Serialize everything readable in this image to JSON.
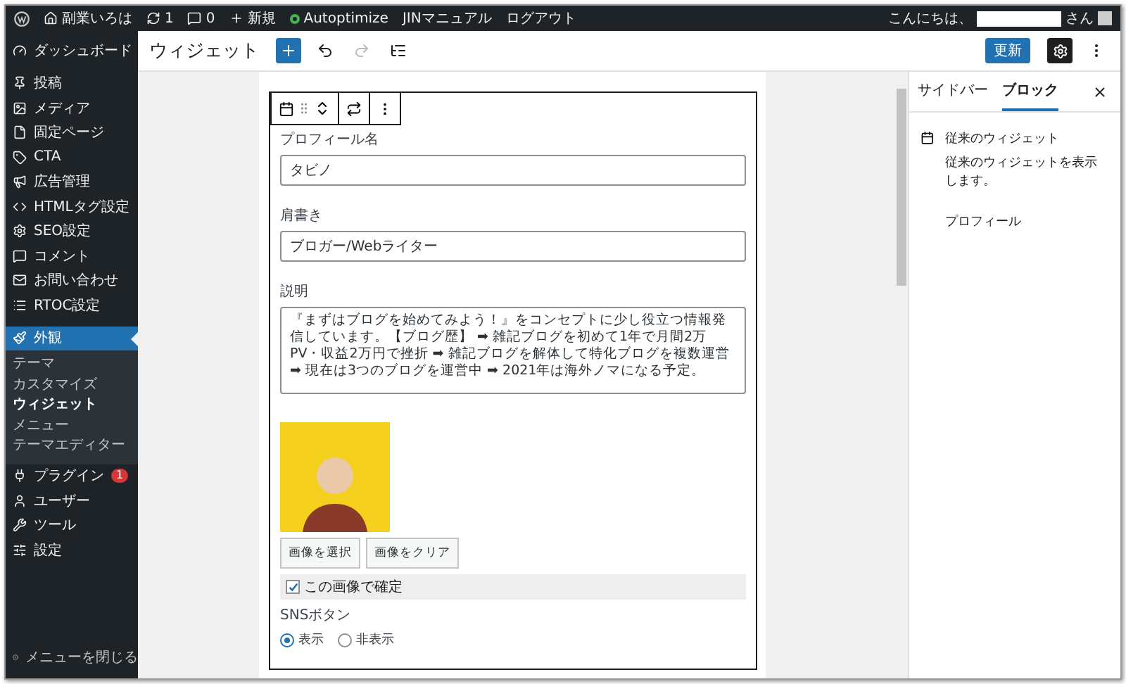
{
  "admin_bar": {
    "site": "副業いろは",
    "updates": "1",
    "comments": "0",
    "new": "新規",
    "plugin": {
      "label": "Autoptimize",
      "color": "#46b450"
    },
    "links": [
      "JINマニュアル",
      "ログアウト"
    ],
    "greeting": "こんにちは、",
    "greeting_suffix": "さん"
  },
  "sidebar": {
    "items": [
      {
        "label": "ダッシュボード",
        "selected": false
      },
      {
        "label": "投稿",
        "selected": false
      },
      {
        "label": "メディア",
        "selected": false
      },
      {
        "label": "固定ページ",
        "selected": false
      },
      {
        "label": "CTA",
        "selected": false
      },
      {
        "label": "広告管理",
        "selected": false
      },
      {
        "label": "HTMLタグ設定",
        "selected": false
      },
      {
        "label": "SEO設定",
        "selected": false
      },
      {
        "label": "コメント",
        "selected": false
      },
      {
        "label": "お問い合わせ",
        "selected": false
      },
      {
        "label": "RTOC設定",
        "selected": false
      },
      {
        "label": "外観",
        "selected": true,
        "children": [
          {
            "label": "テーマ",
            "selected": false
          },
          {
            "label": "カスタマイズ",
            "selected": false
          },
          {
            "label": "ウィジェット",
            "selected": true
          },
          {
            "label": "メニュー",
            "selected": false
          },
          {
            "label": "テーマエディター",
            "selected": false
          }
        ]
      },
      {
        "label": "プラグイン",
        "selected": false,
        "badge": "1"
      },
      {
        "label": "ユーザー",
        "selected": false
      },
      {
        "label": "ツール",
        "selected": false
      },
      {
        "label": "設定",
        "selected": false
      }
    ],
    "collapse": "メニューを閉じる"
  },
  "header": {
    "title": "ウィジェット",
    "update_button": "更新"
  },
  "block": {
    "fields": [
      {
        "kind": "text",
        "label": "プロフィール名",
        "value": "タビノ"
      },
      {
        "kind": "text",
        "label": "肩書き",
        "value": "ブロガー/Webライター"
      },
      {
        "kind": "textarea",
        "label": "説明",
        "value": "『まずはブログを始めてみよう！』をコンセプトに少し役立つ情報発信しています。【ブログ歴】 ➡ 雑記ブログを初めて1年で月間2万PV・収益2万円で挫折 ➡ 雑記ブログを解体して特化ブログを複数運営 ➡ 現在は3つのブログを運営中 ➡ 2021年は海外ノマになる予定。"
      }
    ],
    "image_buttons": [
      "画像を選択",
      "画像をクリア"
    ],
    "confirm": {
      "label": "この画像で確定",
      "checked": true
    },
    "sns": {
      "label": "SNSボタン",
      "options": [
        {
          "label": "表示",
          "selected": true
        },
        {
          "label": "非表示",
          "selected": false
        }
      ]
    }
  },
  "panel": {
    "tabs": [
      {
        "label": "サイドバー",
        "selected": false
      },
      {
        "label": "ブロック",
        "selected": true
      }
    ],
    "block_title": "従来のウィジェット",
    "block_desc": "従来のウィジェットを表示します。",
    "widget_name": "プロフィール"
  }
}
